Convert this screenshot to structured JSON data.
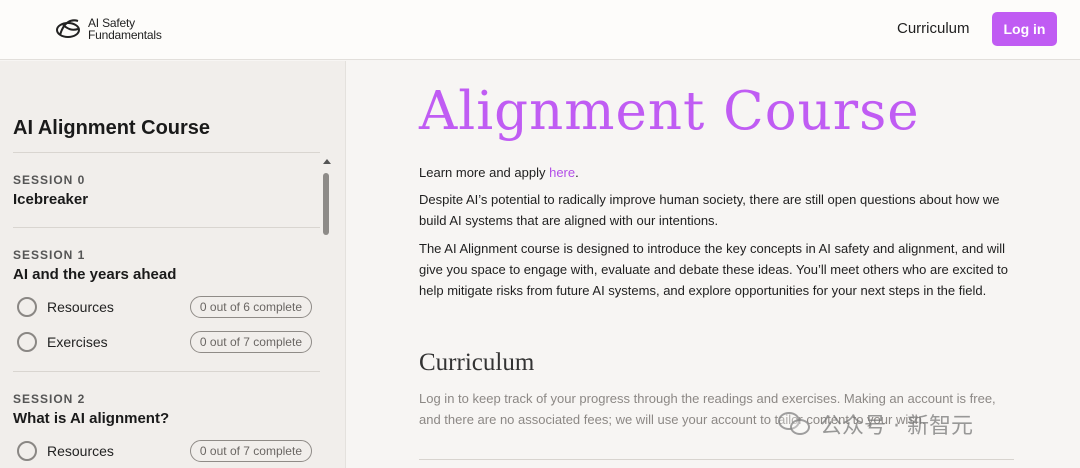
{
  "header": {
    "logo_line1": "AI Safety",
    "logo_line2": "Fundamentals",
    "nav_curriculum": "Curriculum",
    "login_label": "Log in",
    "accent_color": "#c05cf3"
  },
  "sidebar": {
    "title": "AI Alignment Course",
    "sessions": [
      {
        "label": "SESSION 0",
        "name": "Icebreaker",
        "items": []
      },
      {
        "label": "SESSION 1",
        "name": "AI and the years ahead",
        "items": [
          {
            "label": "Resources",
            "progress": "0 out of 6 complete"
          },
          {
            "label": "Exercises",
            "progress": "0 out of 7 complete"
          }
        ]
      },
      {
        "label": "SESSION 2",
        "name": "What is AI alignment?",
        "items": [
          {
            "label": "Resources",
            "progress": "0 out of 7 complete"
          }
        ]
      }
    ]
  },
  "main": {
    "title": "Alignment Course",
    "learn_more_prefix": "Learn more and apply ",
    "learn_more_link": "here",
    "learn_more_suffix": ".",
    "para1": "Despite AI’s potential to radically improve human society, there are still open questions about how we build AI systems that are aligned with our intentions.",
    "para2": "The AI Alignment course is designed to introduce the key concepts in AI safety and alignment, and will give you space to engage with, evaluate and debate these ideas. You’ll meet others who are excited to help mitigate risks from future AI systems, and explore opportunities for your next steps in the field.",
    "curriculum_heading": "Curriculum",
    "curriculum_text": "Log in to keep track of your progress through the readings and exercises. Making an account is free, and there are no associated fees; we will use your account to tailor content to your wish."
  },
  "watermark": {
    "text": "公众号 · 新智元",
    "icon": "wechat-icon"
  }
}
